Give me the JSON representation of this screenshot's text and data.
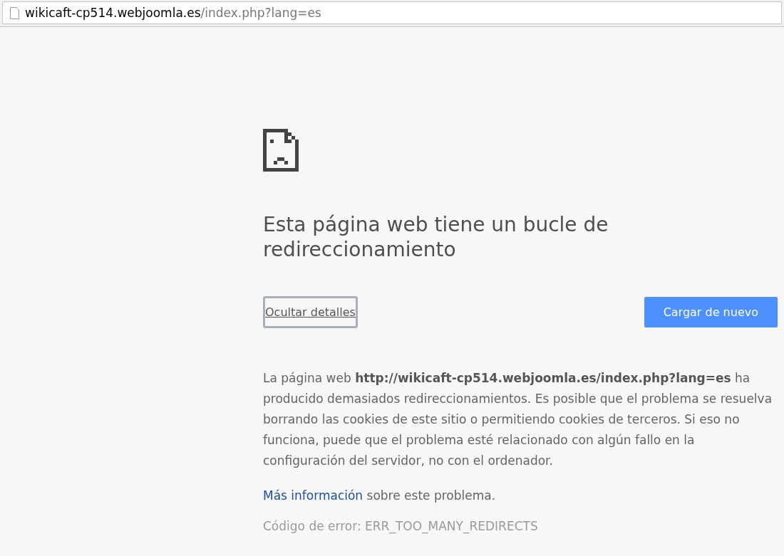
{
  "address_bar": {
    "host": "wikicaft-cp514.webjoomla.es",
    "path": "/index.php?lang=es"
  },
  "heading": "Esta página web tiene un bucle de redireccionamiento",
  "details_button": {
    "label": "Ocultar detalles",
    "focused": true
  },
  "reload_button": {
    "label": "Cargar de nuevo"
  },
  "details": "La página web **http://wikicaft-cp514.webjoomla.es/index.php?lang=es** ha producido demasiados redireccionamientos. Es posible que el problema se resuelva borrando las cookies de este sitio o permitiendo cookies de terceros. Si eso no funciona, puede que el problema esté relacionado con algún fallo en la configuración del servidor, no con el ordenador.",
  "more_info": {
    "link": "Más información",
    "text": "sobre este problema."
  },
  "error_code": "Código de error: ERR_TOO_MANY_REDIRECTS"
}
